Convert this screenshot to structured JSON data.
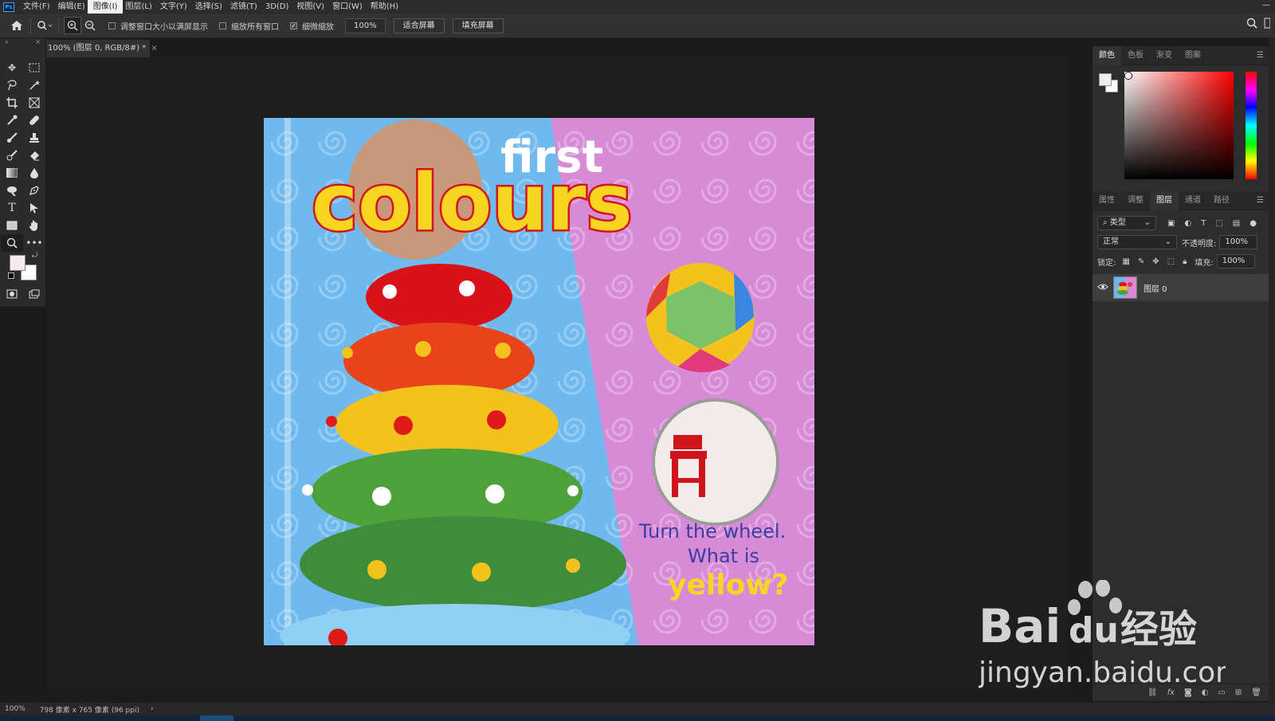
{
  "app": {
    "logo": "Ps"
  },
  "menubar": {
    "items": [
      "文件(F)",
      "编辑(E)",
      "图像(I)",
      "图层(L)",
      "文字(Y)",
      "选择(S)",
      "滤镜(T)",
      "3D(D)",
      "视图(V)",
      "窗口(W)",
      "帮助(H)"
    ],
    "active_index": 2
  },
  "options": {
    "resize_windows_label": "调整窗口大小以满屏显示",
    "zoom_all_label": "缩放所有窗口",
    "scrubby_zoom_label": "细微缩放",
    "zoom_value": "100%",
    "fit_screen_label": "适合屏幕",
    "fill_screen_label": "填充屏幕"
  },
  "document": {
    "tab_title": "100% (图层 0, RGB/8#) *",
    "close": "×",
    "artwork": {
      "title_small": "first",
      "title_big": "colours",
      "caption_line1": "Turn the wheel.",
      "caption_line2": "What is",
      "caption_line3": "yellow?"
    }
  },
  "status": {
    "zoom": "100%",
    "doc_info": "798 像素 x 765 像素 (96 ppi)",
    "arrow": "›"
  },
  "panels": {
    "color_tabs": [
      "颜色",
      "色板",
      "渐变",
      "图案"
    ],
    "layer_tabs": [
      "属性",
      "调整",
      "图层",
      "通道",
      "路径"
    ],
    "filter_kind": "类型",
    "blend_mode": "正常",
    "opacity_label": "不透明度:",
    "opacity_value": "100%",
    "lock_label": "锁定:",
    "fill_label": "填充:",
    "fill_value": "100%",
    "layer_name": "图层 0"
  },
  "watermark": {
    "brand_text": "Bai",
    "brand_text2": "du",
    "brand_cn": "经验",
    "url": "jingyan.baidu.com"
  },
  "colors": {
    "foreground": "#f7eaea",
    "background": "#ffffff",
    "accent": "#31a8ff"
  }
}
